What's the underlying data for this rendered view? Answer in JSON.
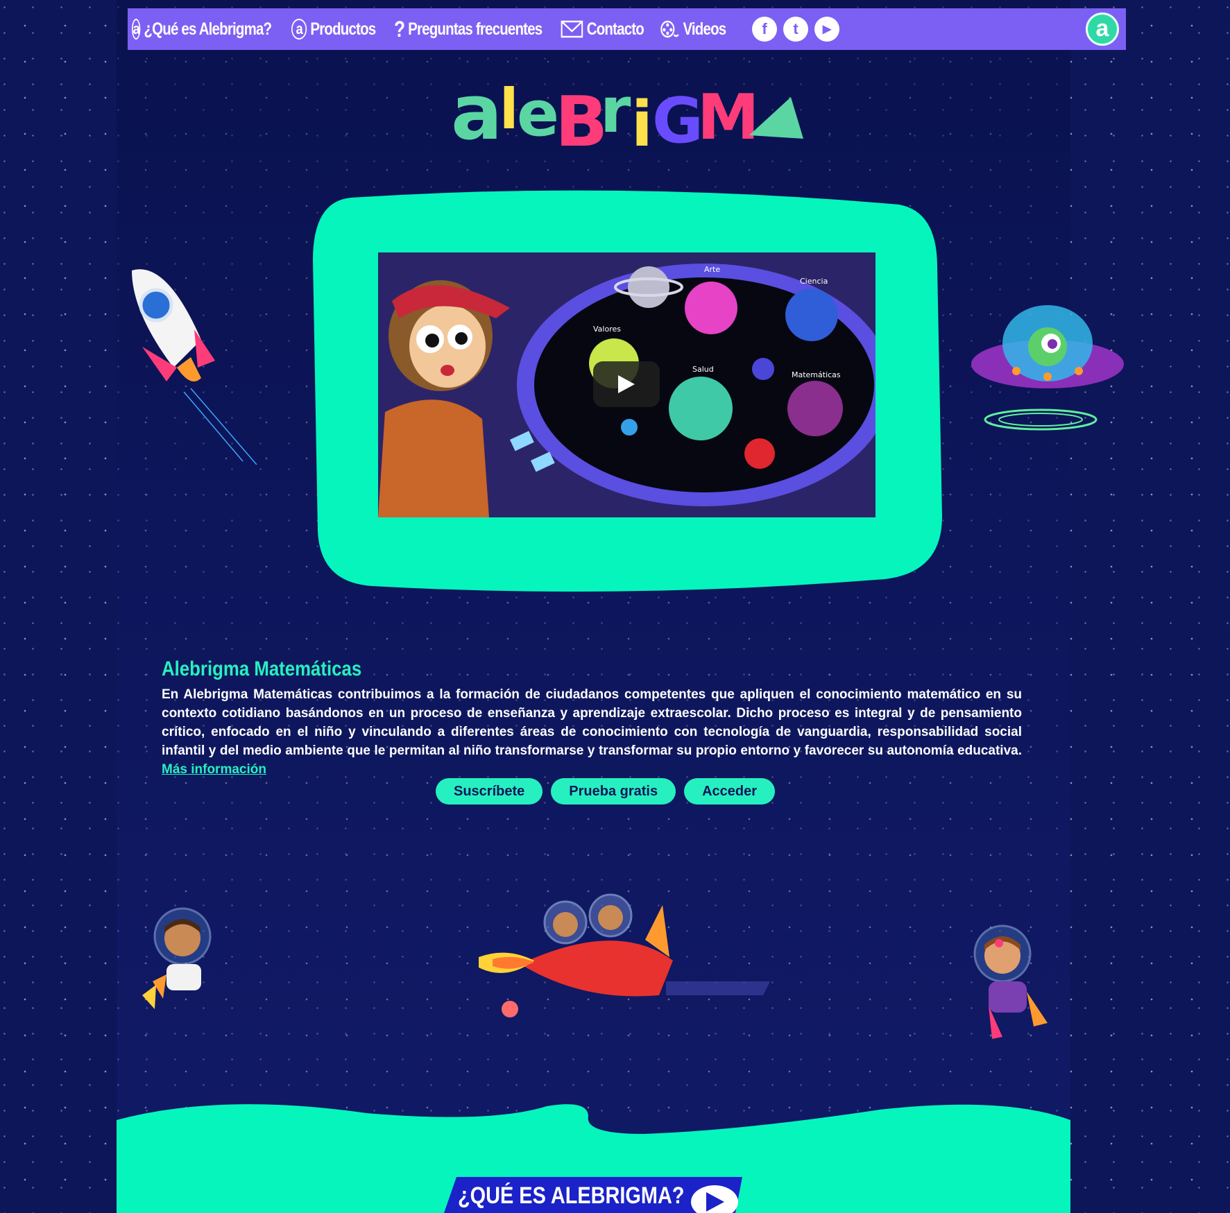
{
  "nav": {
    "items": [
      {
        "label": "¿Qué es Alebrigma?",
        "icon": "alebrigma-a-icon"
      },
      {
        "label": "Productos",
        "icon": "alebrigma-a-icon"
      },
      {
        "label": "Preguntas frecuentes",
        "icon": "question-icon"
      },
      {
        "label": "Contacto",
        "icon": "envelope-icon"
      },
      {
        "label": "Videos",
        "icon": "film-reel-icon"
      }
    ],
    "social": [
      {
        "name": "facebook-icon",
        "glyph": "f"
      },
      {
        "name": "twitter-icon",
        "glyph": "t"
      },
      {
        "name": "youtube-icon",
        "glyph": "▶"
      }
    ],
    "badge_glyph": "a"
  },
  "logo": {
    "text": "alebrigma"
  },
  "video": {
    "planet_labels": [
      "Arte",
      "Ciencia",
      "Valores",
      "Salud",
      "Matemáticas"
    ]
  },
  "section": {
    "title": "Alebrigma Matemáticas",
    "description": "En Alebrigma Matemáticas contribuimos a la formación de ciudadanos competentes que apliquen el conocimiento matemático en su contexto cotidiano basándonos en un proceso de enseñanza y aprendizaje extraescolar. Dicho proceso es integral y de pensamiento crítico, enfocado en el niño y vinculando a diferentes áreas de conocimiento con tecnología de vanguardia, responsabilidad social infantil y del medio ambiente que le permitan al niño transformarse y transformar su propio entorno y favorecer su autonomía educativa.",
    "more_link": "Más información",
    "buttons": [
      "Suscríbete",
      "Prueba gratis",
      "Acceder"
    ]
  },
  "footer": {
    "banner": "¿QUÉ ES ALEBRIGMA?"
  },
  "colors": {
    "background": "#0d1659",
    "nav": "#7c60f3",
    "accent": "#26f0bf",
    "logo_letters": [
      "#5bd6a3",
      "#ffe14b",
      "#ff3c7a",
      "#ff8a3c",
      "#6a4cff"
    ]
  }
}
